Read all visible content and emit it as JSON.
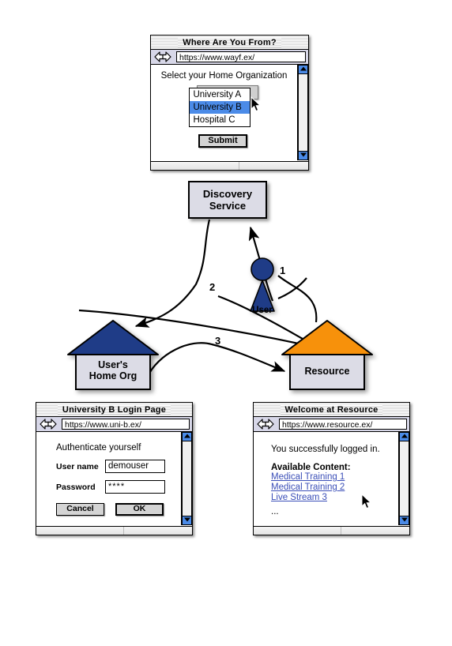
{
  "wayf_window": {
    "title": "Where Are You From?",
    "url": "https://www.wayf.ex/",
    "nav_icon": "back-forward-arrows-icon",
    "prompt": "Select your Home Organization",
    "options": [
      {
        "label": "University A",
        "selected": false
      },
      {
        "label": "University B",
        "selected": true
      },
      {
        "label": "Hospital C",
        "selected": false
      }
    ],
    "submit_label": "Submit",
    "highlight_color": "#4b8be8"
  },
  "diagram": {
    "discovery_service": {
      "line1": "Discovery",
      "line2": "Service"
    },
    "user": {
      "label": "User",
      "color": "#1f3c87"
    },
    "home_org": {
      "line1": "User's",
      "line2": "Home Org",
      "roof_color": "#1f3c87"
    },
    "resource": {
      "line1": "Resource",
      "roof_color": "#f7910b"
    },
    "step_numbers": [
      "1",
      "2",
      "3"
    ]
  },
  "login_window": {
    "title": "University B Login Page",
    "url": "https://www.uni-b.ex/",
    "nav_icon": "back-forward-arrows-icon",
    "heading": "Authenticate yourself",
    "username_label": "User name",
    "username_value": "demouser",
    "password_label": "Password",
    "password_value": "****",
    "cancel_label": "Cancel",
    "ok_label": "OK"
  },
  "resource_window": {
    "title": "Welcome at Resource",
    "url": "https://www.resource.ex/",
    "nav_icon": "back-forward-arrows-icon",
    "message": "You successfully logged in.",
    "content_heading": "Available Content:",
    "links": [
      "Medical Training 1",
      "Medical Training 2",
      "Live Stream 3"
    ],
    "ellipsis": "...",
    "link_color": "#3b4fb8"
  }
}
